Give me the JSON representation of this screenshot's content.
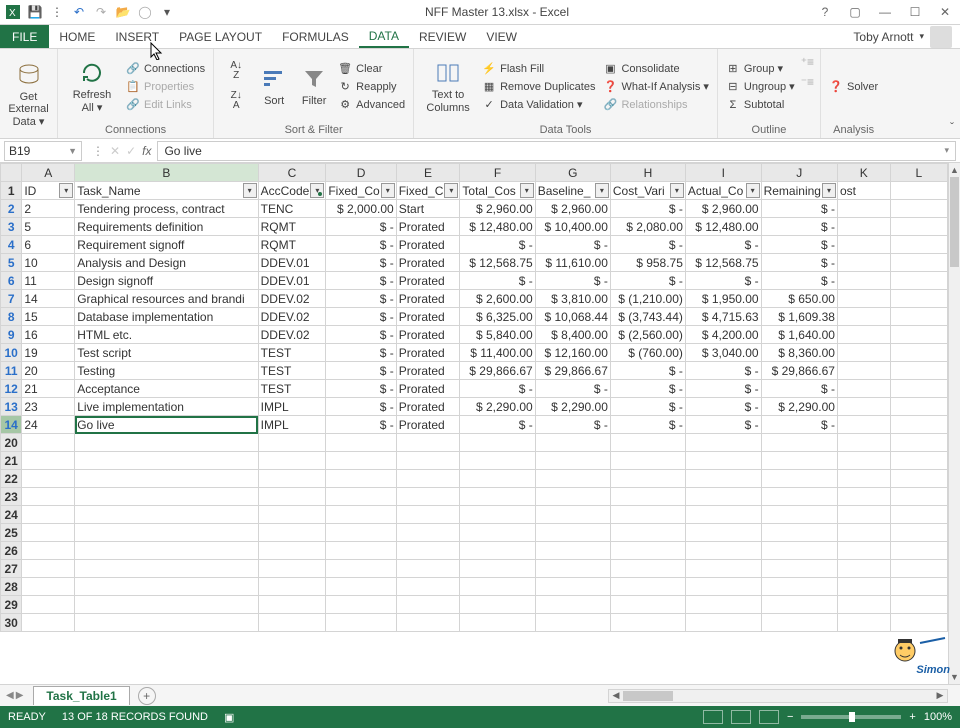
{
  "title": "NFF Master 13.xlsx - Excel",
  "user": "Toby Arnott",
  "tabs": {
    "file": "FILE",
    "home": "HOME",
    "insert": "INSERT",
    "page_layout": "PAGE LAYOUT",
    "formulas": "FORMULAS",
    "data": "DATA",
    "review": "REVIEW",
    "view": "VIEW"
  },
  "ribbon": {
    "get_external_data": {
      "label": "Get External\nData ▾",
      "group": ""
    },
    "refresh_all": {
      "label": "Refresh\nAll ▾"
    },
    "connections": {
      "conn": "Connections",
      "props": "Properties",
      "edit": "Edit Links",
      "group": "Connections"
    },
    "sort": "Sort",
    "filter": "Filter",
    "clear": "Clear",
    "reapply": "Reapply",
    "advanced": "Advanced",
    "sort_filter_group": "Sort & Filter",
    "text_to_columns": "Text to\nColumns",
    "flash_fill": "Flash Fill",
    "remove_dup": "Remove Duplicates",
    "data_val": "Data Validation ▾",
    "consolidate": "Consolidate",
    "whatif": "What-If Analysis ▾",
    "relationships": "Relationships",
    "data_tools_group": "Data Tools",
    "group": "Group ▾",
    "ungroup": "Ungroup ▾",
    "subtotal": "Subtotal",
    "outline_group": "Outline",
    "solver": "Solver",
    "analysis_group": "Analysis"
  },
  "namebox": "B19",
  "formula": "Go live",
  "col_headers": [
    "A",
    "B",
    "C",
    "D",
    "E",
    "F",
    "G",
    "H",
    "I",
    "J",
    "K",
    "L"
  ],
  "data_headers": {
    "a": "ID",
    "b": "Task_Name",
    "c": "AccCode",
    "d": "Fixed_Co",
    "e": "Fixed_C",
    "f": "Total_Cos",
    "g": "Baseline_",
    "h": "Cost_Vari",
    "i": "Actual_Co",
    "j": "Remaining",
    "k": "ost"
  },
  "rows": [
    {
      "rh": "2",
      "id": "2",
      "task": "Tendering process, contract",
      "code": "TENC",
      "fc": "$ 2,000.00",
      "fa": "Start",
      "tot": "$   2,960.00",
      "base": "$   2,960.00",
      "var": "$             -",
      "act": "$   2,960.00",
      "rem": "$             -"
    },
    {
      "rh": "3",
      "id": "5",
      "task": "Requirements definition",
      "code": "RQMT",
      "fc": "$           -",
      "fa": "Prorated",
      "tot": "$ 12,480.00",
      "base": "$ 10,400.00",
      "var": "$   2,080.00",
      "act": "$ 12,480.00",
      "rem": "$             -"
    },
    {
      "rh": "4",
      "id": "6",
      "task": "Requirement signoff",
      "code": "RQMT",
      "fc": "$           -",
      "fa": "Prorated",
      "tot": "$             -",
      "base": "$             -",
      "var": "$             -",
      "act": "$             -",
      "rem": "$             -"
    },
    {
      "rh": "5",
      "id": "10",
      "task": "Analysis and Design",
      "code": "DDEV.01",
      "fc": "$           -",
      "fa": "Prorated",
      "tot": "$ 12,568.75",
      "base": "$ 11,610.00",
      "var": "$      958.75",
      "act": "$ 12,568.75",
      "rem": "$             -"
    },
    {
      "rh": "6",
      "id": "11",
      "task": "Design signoff",
      "code": "DDEV.01",
      "fc": "$           -",
      "fa": "Prorated",
      "tot": "$             -",
      "base": "$             -",
      "var": "$             -",
      "act": "$             -",
      "rem": "$             -"
    },
    {
      "rh": "7",
      "id": "14",
      "task": "Graphical resources and brandi",
      "code": "DDEV.02",
      "fc": "$           -",
      "fa": "Prorated",
      "tot": "$   2,600.00",
      "base": "$   3,810.00",
      "var": "$ (1,210.00)",
      "act": "$   1,950.00",
      "rem": "$      650.00"
    },
    {
      "rh": "8",
      "id": "15",
      "task": "Database implementation",
      "code": "DDEV.02",
      "fc": "$           -",
      "fa": "Prorated",
      "tot": "$   6,325.00",
      "base": "$ 10,068.44",
      "var": "$ (3,743.44)",
      "act": "$   4,715.63",
      "rem": "$   1,609.38"
    },
    {
      "rh": "9",
      "id": "16",
      "task": "HTML etc.",
      "code": "DDEV.02",
      "fc": "$           -",
      "fa": "Prorated",
      "tot": "$   5,840.00",
      "base": "$   8,400.00",
      "var": "$ (2,560.00)",
      "act": "$   4,200.00",
      "rem": "$   1,640.00"
    },
    {
      "rh": "10",
      "id": "19",
      "task": "Test script",
      "code": "TEST",
      "fc": "$           -",
      "fa": "Prorated",
      "tot": "$ 11,400.00",
      "base": "$ 12,160.00",
      "var": "$    (760.00)",
      "act": "$   3,040.00",
      "rem": "$   8,360.00"
    },
    {
      "rh": "11",
      "id": "20",
      "task": "Testing",
      "code": "TEST",
      "fc": "$           -",
      "fa": "Prorated",
      "tot": "$ 29,866.67",
      "base": "$ 29,866.67",
      "var": "$             -",
      "act": "$             -",
      "rem": "$ 29,866.67"
    },
    {
      "rh": "12",
      "id": "21",
      "task": "Acceptance",
      "code": "TEST",
      "fc": "$           -",
      "fa": "Prorated",
      "tot": "$             -",
      "base": "$             -",
      "var": "$             -",
      "act": "$             -",
      "rem": "$             -"
    },
    {
      "rh": "13",
      "id": "23",
      "task": "Live implementation",
      "code": "IMPL",
      "fc": "$           -",
      "fa": "Prorated",
      "tot": "$   2,290.00",
      "base": "$   2,290.00",
      "var": "$             -",
      "act": "$             -",
      "rem": "$   2,290.00"
    },
    {
      "rh": "14",
      "id": "24",
      "task": "Go live",
      "code": "IMPL",
      "fc": "$           -",
      "fa": "Prorated",
      "tot": "$             -",
      "base": "$             -",
      "var": "$             -",
      "act": "$             -",
      "rem": "$             -"
    }
  ],
  "empty_rows": [
    "20",
    "21",
    "22",
    "23",
    "24",
    "25",
    "26",
    "27",
    "28",
    "29",
    "30"
  ],
  "sheet_tab": "Task_Table1",
  "status": {
    "ready": "READY",
    "records": "13 OF 18 RECORDS FOUND",
    "zoom": "100%"
  },
  "watermark": "Simon"
}
